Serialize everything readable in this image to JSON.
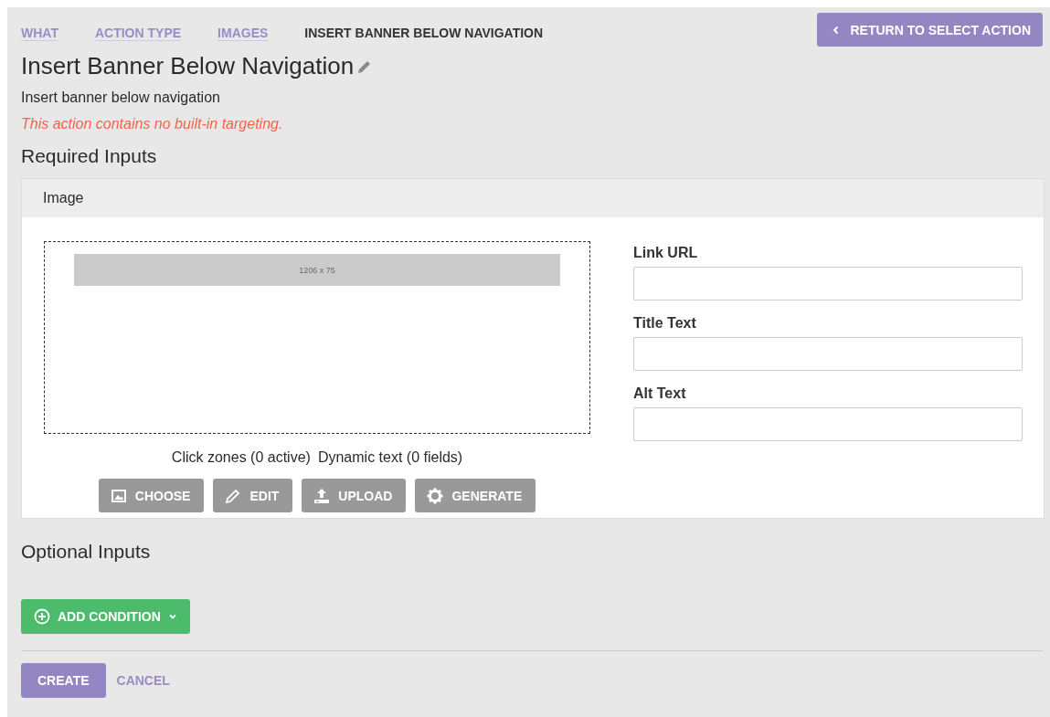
{
  "breadcrumbs": [
    {
      "label": "WHAT",
      "selected": false
    },
    {
      "label": "ACTION TYPE",
      "selected": false
    },
    {
      "label": "IMAGES",
      "selected": false
    },
    {
      "label": "INSERT BANNER BELOW NAVIGATION",
      "selected": true
    }
  ],
  "return_button": "RETURN TO SELECT ACTION",
  "title": "Insert Banner Below Navigation",
  "description": "Insert banner below navigation",
  "warning": "This action contains no built-in targeting.",
  "required_heading": "Required Inputs",
  "image_panel": {
    "title": "Image",
    "placeholder_size": "1206 x 75",
    "click_zones": "Click zones (0 active)",
    "dynamic_text": "Dynamic text (0 fields)",
    "buttons": [
      {
        "label": "CHOOSE",
        "kind": "image"
      },
      {
        "label": "EDIT",
        "kind": "pencil"
      },
      {
        "label": "UPLOAD",
        "kind": "upload"
      },
      {
        "label": "GENERATE",
        "kind": "gear"
      }
    ],
    "fields": [
      {
        "label": "Link URL"
      },
      {
        "label": "Title Text"
      },
      {
        "label": "Alt Text"
      }
    ]
  },
  "optional_heading": "Optional Inputs",
  "add_condition": "ADD CONDITION",
  "create": "CREATE",
  "cancel": "CANCEL"
}
